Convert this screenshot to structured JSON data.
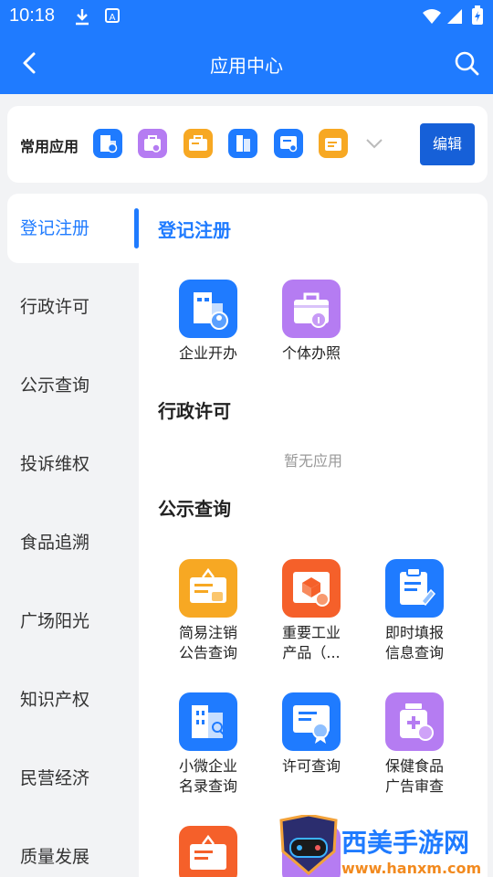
{
  "status_bar": {
    "time": "10:18"
  },
  "header": {
    "title": "应用中心"
  },
  "common_apps": {
    "label": "常用应用",
    "edit_label": "编辑"
  },
  "sidebar": {
    "items": [
      {
        "label": "登记注册",
        "active": true
      },
      {
        "label": "行政许可"
      },
      {
        "label": "公示查询"
      },
      {
        "label": "投诉维权"
      },
      {
        "label": "食品追溯"
      },
      {
        "label": "广场阳光"
      },
      {
        "label": "知识产权"
      },
      {
        "label": "民营经济"
      },
      {
        "label": "质量发展"
      }
    ]
  },
  "sections": {
    "register": {
      "title": "登记注册",
      "apps": [
        {
          "label": "企业开办",
          "icon": "enterprise-icon",
          "color": "#1f7bff"
        },
        {
          "label": "个体办照",
          "icon": "briefcase-icon",
          "color": "#b57cf2"
        }
      ]
    },
    "license": {
      "title": "行政许可",
      "empty_text": "暂无应用"
    },
    "publicity": {
      "title": "公示查询",
      "apps": [
        {
          "label1": "简易注销",
          "label2": "公告查询",
          "icon": "notice-board-icon",
          "color": "#f7a823"
        },
        {
          "label1": "重要工业",
          "label2": "产品（...",
          "icon": "product-box-icon",
          "color": "#f5602a"
        },
        {
          "label1": "即时填报",
          "label2": "信息查询",
          "icon": "clipboard-icon",
          "color": "#1f7bff"
        },
        {
          "label1": "小微企业",
          "label2": "名录查询",
          "icon": "building-search-icon",
          "color": "#1f7bff"
        },
        {
          "label1": "许可查询",
          "label2": "",
          "icon": "certificate-icon",
          "color": "#1f7bff"
        },
        {
          "label1": "保健食品",
          "label2": "广告审查",
          "icon": "bottle-icon",
          "color": "#b57cf2"
        }
      ]
    }
  },
  "watermark": {
    "text": "西美手游网",
    "url": "www.hanxm.com"
  }
}
